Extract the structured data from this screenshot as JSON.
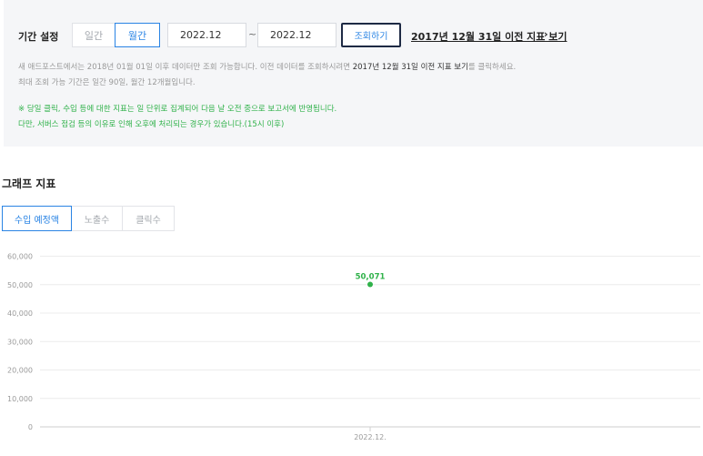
{
  "filter": {
    "period_label": "기간 설정",
    "daily_label": "일간",
    "monthly_label": "월간",
    "start_date": "2022.12",
    "separator": "~",
    "end_date": "2022.12",
    "search_button": "조회하기",
    "legacy_link": "2017년 12월 31일 이전 지표 보기",
    "legacy_arrow": "›"
  },
  "notices": {
    "line1_pre": "새 애드포스트에서는 2018년 01월 01일 이후 데이터만 조회 가능합니다. 이전 데이터를 조회하시려면 ",
    "line1_link": "2017년 12월 31일 이전 지표 보기",
    "line1_post": "를 클릭하세요.",
    "line2": "최대 조회 가능 기간은 일간 90일, 월간 12개월입니다.",
    "line3": "※ 당일 클릭, 수입 등에 대한 지표는 일 단위로 집계되어 다음 날 오전 중으로 보고서에 반영됩니다.",
    "line4": "다만, 서버스 점검 등의 이유로 인해 오후에 처리되는 경우가 있습니다.(15시 이후)"
  },
  "graph": {
    "title": "그래프 지표",
    "tabs": [
      "수입 예정액",
      "노출수",
      "클릭수"
    ]
  },
  "colors": {
    "accent": "#2a84e4",
    "series": "#30b24a",
    "panel_bg": "#f5f6f8"
  },
  "chart_data": {
    "type": "line",
    "categories": [
      "2022.12."
    ],
    "series": [
      {
        "values": [
          50071
        ]
      }
    ],
    "data_labels": [
      "50,071"
    ],
    "y_ticks": [
      "0",
      "10,000",
      "20,000",
      "30,000",
      "40,000",
      "50,000",
      "60,000"
    ],
    "ylim": [
      0,
      60000
    ],
    "grid": true
  }
}
